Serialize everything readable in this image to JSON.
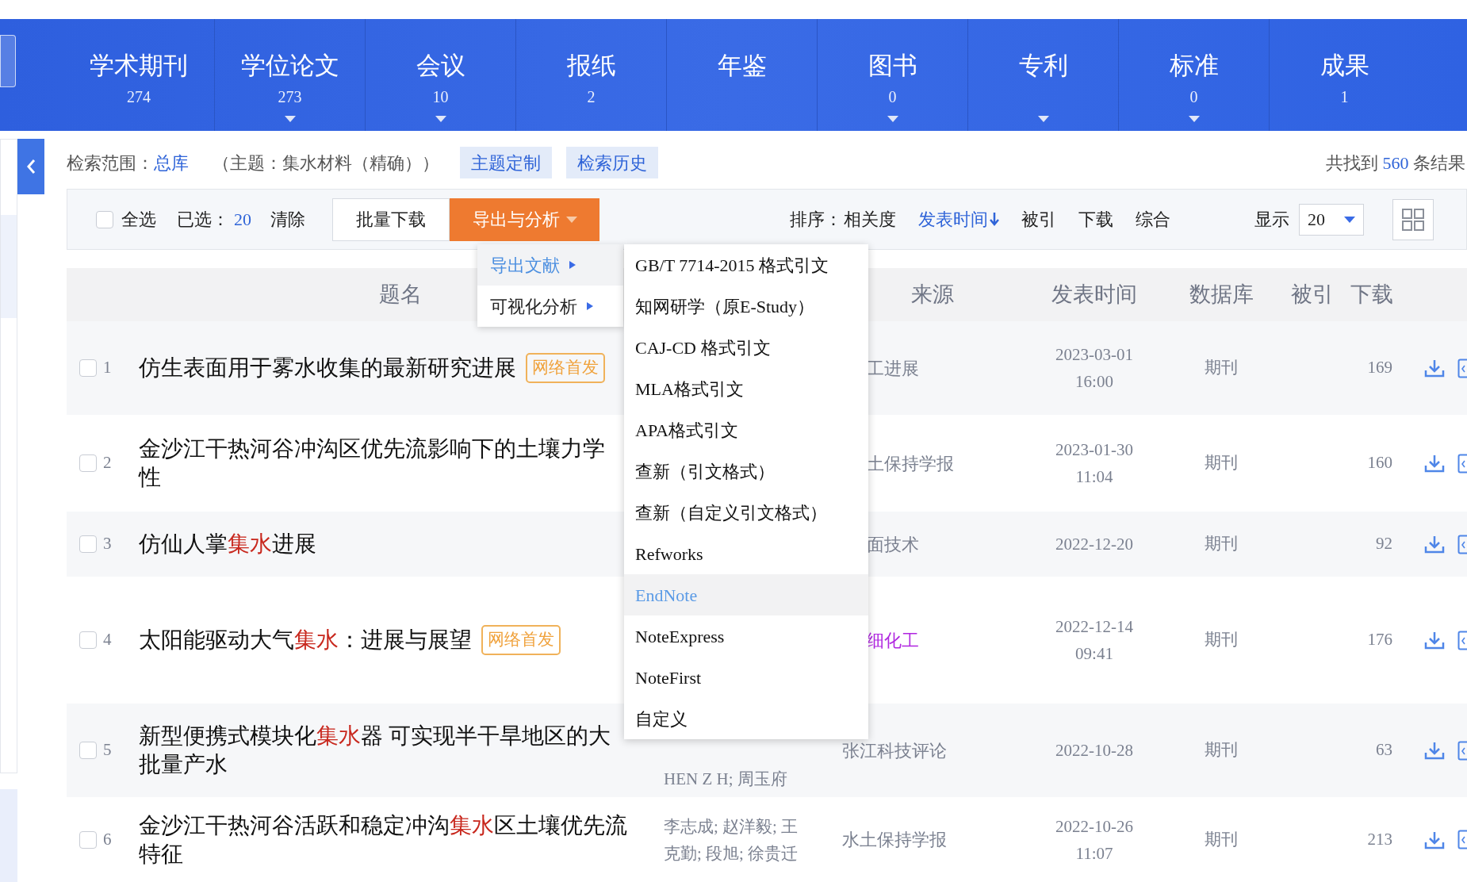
{
  "nav_tabs": [
    {
      "label": "学术期刊",
      "count": "274",
      "has_menu": false
    },
    {
      "label": "学位论文",
      "count": "273",
      "has_menu": true
    },
    {
      "label": "会议",
      "count": "10",
      "has_menu": true
    },
    {
      "label": "报纸",
      "count": "2",
      "has_menu": false
    },
    {
      "label": "年鉴",
      "has_menu": false
    },
    {
      "label": "图书",
      "count": "0",
      "has_menu": true
    },
    {
      "label": "专利",
      "has_menu": true
    },
    {
      "label": "标准",
      "count": "0",
      "has_menu": true
    },
    {
      "label": "成果",
      "count": "1",
      "has_menu": false
    }
  ],
  "search_scope": {
    "label": "检索范围：",
    "value": "总库",
    "query": "（主题：集水材料（精确））",
    "buttons": [
      "主题定制",
      "检索历史"
    ],
    "result_prefix": "共找到",
    "result_count": "560",
    "result_suffix": "条结果"
  },
  "toolbar": {
    "select_all": {
      "label": "全选",
      "checked": false
    },
    "selected_label": "已选：",
    "selected_count": "20",
    "clear": "清除",
    "batch_download": "批量下载",
    "export": "导出与分析",
    "sort_label": "排序：",
    "sort_options": [
      {
        "label": "相关度",
        "selected": false
      },
      {
        "label": "发表时间",
        "selected": true
      },
      {
        "label": "被引",
        "selected": false
      },
      {
        "label": "下载",
        "selected": false
      },
      {
        "label": "综合",
        "selected": false
      }
    ],
    "display_label": "显示",
    "page_size": "20"
  },
  "export_menu": {
    "items": [
      {
        "label": "导出文献",
        "selected": true
      },
      {
        "label": "可视化分析",
        "selected": false
      }
    ],
    "submenu": [
      {
        "label": "GB/T 7714-2015 格式引文",
        "hovered": false
      },
      {
        "label": "知网研学（原E-Study）",
        "hovered": false
      },
      {
        "label": "CAJ-CD 格式引文",
        "hovered": false
      },
      {
        "label": "MLA格式引文",
        "hovered": false
      },
      {
        "label": "APA格式引文",
        "hovered": false
      },
      {
        "label": "查新（引文格式）",
        "hovered": false
      },
      {
        "label": "查新（自定义引文格式）",
        "hovered": false
      },
      {
        "label": "Refworks",
        "hovered": false
      },
      {
        "label": "EndNote",
        "hovered": true
      },
      {
        "label": "NoteExpress",
        "hovered": false
      },
      {
        "label": "NoteFirst",
        "hovered": false
      },
      {
        "label": "自定义",
        "hovered": false
      }
    ]
  },
  "table": {
    "columns": [
      "题名",
      "来源",
      "发表时间",
      "数据库",
      "被引",
      "下载"
    ],
    "rows": [
      {
        "number": "1",
        "checked": false,
        "title": [
          [
            {
              "text": "仿生表面用于雾水收集的最新研究进展",
              "highlight": false
            }
          ]
        ],
        "badge": "网络首发",
        "source": "工进展",
        "source_visited": false,
        "date": [
          "2023-03-01",
          "16:00"
        ],
        "database": "期刊",
        "downloads": "169"
      },
      {
        "number": "2",
        "checked": false,
        "title": [
          [
            {
              "text": "金沙江干热河谷冲沟区优先流影响下的土壤力学",
              "highlight": false
            }
          ],
          [
            {
              "text": "性",
              "highlight": false
            }
          ]
        ],
        "source": "土保持学报",
        "source_visited": false,
        "date": [
          "2023-01-30",
          "11:04"
        ],
        "database": "期刊",
        "downloads": "160"
      },
      {
        "number": "3",
        "checked": false,
        "title": [
          [
            {
              "text": "仿仙人掌",
              "highlight": false
            },
            {
              "text": "集水",
              "highlight": true
            },
            {
              "text": "进展",
              "highlight": false
            }
          ]
        ],
        "source": "面技术",
        "source_visited": false,
        "date": [
          "2022-12-20"
        ],
        "database": "期刊",
        "downloads": "92"
      },
      {
        "number": "4",
        "checked": false,
        "title": [
          [
            {
              "text": "太阳能驱动大气",
              "highlight": false
            },
            {
              "text": "集水",
              "highlight": true
            },
            {
              "text": "：进展与展望",
              "highlight": false
            }
          ]
        ],
        "badge": "网络首发",
        "source": "细化工",
        "source_visited": true,
        "date": [
          "2022-12-14",
          "09:41"
        ],
        "database": "期刊",
        "downloads": "176"
      },
      {
        "number": "5",
        "checked": false,
        "title": [
          [
            {
              "text": "新型便携式模块化",
              "highlight": false
            },
            {
              "text": "集水",
              "highlight": true
            },
            {
              "text": "器 可实现半干旱地区的大",
              "highlight": false
            }
          ],
          [
            {
              "text": "批量产水",
              "highlight": false
            }
          ]
        ],
        "authors": [
          "HEN Z H; 周玉府"
        ],
        "source": "张江科技评论",
        "source_visited": false,
        "date": [
          "2022-10-28"
        ],
        "database": "期刊",
        "downloads": "63"
      },
      {
        "number": "6",
        "checked": false,
        "title": [
          [
            {
              "text": "金沙江干热河谷活跃和稳定冲沟",
              "highlight": false
            },
            {
              "text": "集水",
              "highlight": true
            },
            {
              "text": "区土壤优先流",
              "highlight": false
            }
          ],
          [
            {
              "text": "特征",
              "highlight": false
            }
          ]
        ],
        "authors": [
          "李志成; 赵洋毅; 王",
          "克勤; 段旭; 徐贵迁"
        ],
        "source": "水土保持学报",
        "source_visited": false,
        "date": [
          "2022-10-26",
          "11:07"
        ],
        "database": "期刊",
        "downloads": "213"
      }
    ]
  }
}
